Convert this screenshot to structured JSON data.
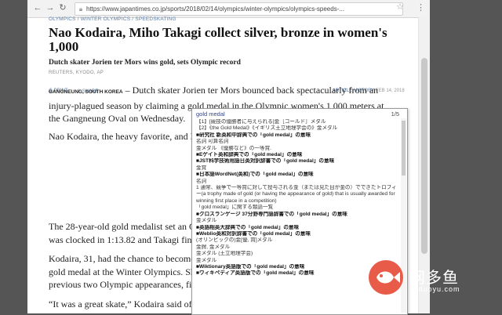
{
  "browser": {
    "url": "https://www.japantimes.co.jp/sports/2018/02/14/olympics/winter-olympics/olympics-speeds-..."
  },
  "article": {
    "breadcrumbs": "OLYMPICS / WINTER OLYMPICS / SPEEDSKATING",
    "headline": "Nao Kodaira, Miho Takagi collect silver, bronze in women's 1,000",
    "subhead": "Dutch skater Jorien ter Mors wins gold, sets Olympic record",
    "credit": "REUTERS, KYODO, AP",
    "print_label": "PRINT",
    "share_label": "SHARE",
    "history_label": "ARTICLE HISTORY",
    "date": "FEB 14, 2018",
    "dateline": "GANGNEUNG, SOUTH KOREA",
    "p1_rest": " – Dutch skater Jorien ter Mors bounced back spectacularly from an",
    "p1_line2": "injury-plagued season by claiming a gold medal in the Olympic women's 1,000 meters at",
    "p1_line3": "the Gangneung Oval on Wednesday.",
    "p2": "Nao Kodaira, the heavy favorite, and Mi",
    "p3_line1": "The 28-year-old gold medalist set an Ol",
    "p3_line2": "was clocked in 1:13.82 and Takagi finish",
    "p4_line1": "Kodaira, 31, had the chance to become",
    "p4_line2": "gold medal at the Winter Olympics. She",
    "p4_line3": "previous two Olympic appearances, fift",
    "p5_line1": "“It was a great skate,” Kodaira said of ter"
  },
  "popup": {
    "word": "gold medal",
    "count": "1/5",
    "lines": [
      {
        "text": "【1】[競技の優勝者に与えられる]金［ゴールド］メダル",
        "bold": false
      },
      {
        "text": "【2】《the Gold Medal》《イギリス王立地理学会の》金メダル",
        "bold": false
      },
      {
        "text": "■研究社 新英和中辞典での「gold medal」の意味",
        "bold": true
      },
      {
        "text": "名詞 可算名詞",
        "bold": false
      },
      {
        "text": "金メダル 《優勝など》の一等賞.",
        "bold": false
      },
      {
        "text": "■Eゲイト英和辞典での「gold medal」の意味",
        "bold": true
      },
      {
        "text": "■JST科学技術用語日英対訳辞書での「gold medal」の意味",
        "bold": true
      },
      {
        "text": "金賞",
        "bold": false
      },
      {
        "text": "■日本語WordNet(英和)での「gold medal」の意味",
        "bold": true
      },
      {
        "text": "名詞",
        "bold": false
      },
      {
        "text": "1 通常、競争で一等賞に対して授与される金（または見た目が金の）でできたトロフィー(a trophy made of gold (or having the appearance of gold) that is usually awarded for winning first place in a competition)",
        "bold": false,
        "wrap": true
      },
      {
        "text": "「gold medal」に関する類語一覧",
        "bold": false
      },
      {
        "text": "■クロスランゲージ 37分野専門語辞書での「gold medal」の意味",
        "bold": true
      },
      {
        "text": "金メダル",
        "bold": false
      },
      {
        "text": "■英語相英大辞典での「gold medal」の意味",
        "bold": true
      },
      {
        "text": "■Weblio英和対訳辞書での「gold medal」の意味",
        "bold": true
      },
      {
        "text": "(オリンピックの)金[優, 賞]メダル",
        "bold": false
      },
      {
        "text": "金牌, 金メダル",
        "bold": false
      },
      {
        "text": "金メダル (王立地理学会)",
        "bold": false
      },
      {
        "text": "金メダル",
        "bold": false
      },
      {
        "text": "■Wiktionary英語版での「gold medal」の意味",
        "bold": true
      },
      {
        "text": "■ウィキペディア英語版での「gold medal」の意味",
        "bold": true
      }
    ]
  },
  "watermark": {
    "title": "网多鱼",
    "site": "wduoyu.com"
  }
}
